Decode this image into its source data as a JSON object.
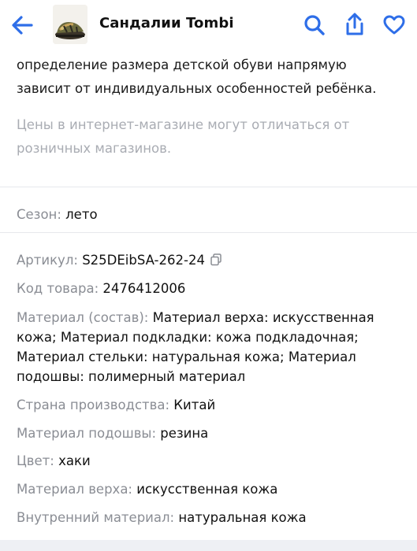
{
  "header": {
    "title": "Сандалии Tombi",
    "back_icon": "arrow-left-icon",
    "search_icon": "search-icon",
    "share_icon": "share-icon",
    "favorite_icon": "heart-icon",
    "accent_color": "#2e6ee8"
  },
  "description": {
    "text": "определение размера детской обуви напрямую зависит от индивидуальных особенностей ребёнка.",
    "price_note": "Цены в интернет-магазине могут отличаться от розничных магазинов."
  },
  "season": {
    "label": "Сезон:",
    "value": "лето"
  },
  "specs": {
    "article": {
      "label": "Артикул:",
      "value": "S25DEibSA-262-24",
      "copy_icon": "copy-icon"
    },
    "product_code": {
      "label": "Код товара:",
      "value": "2476412006"
    },
    "composition": {
      "label": "Материал (состав):",
      "value": "Материал верха: искусственная кожа; Материал подкладки: кожа подкладочная; Материал стельки: натуральная кожа; Материал подошвы: полимерный материал"
    },
    "country": {
      "label": "Страна производства:",
      "value": "Китай"
    },
    "sole": {
      "label": "Материал подошвы:",
      "value": "резина"
    },
    "color": {
      "label": "Цвет:",
      "value": "хаки"
    },
    "upper": {
      "label": "Материал верха:",
      "value": "искусственная кожа"
    },
    "inner": {
      "label": "Внутренний материал:",
      "value": "натуральная кожа"
    }
  }
}
